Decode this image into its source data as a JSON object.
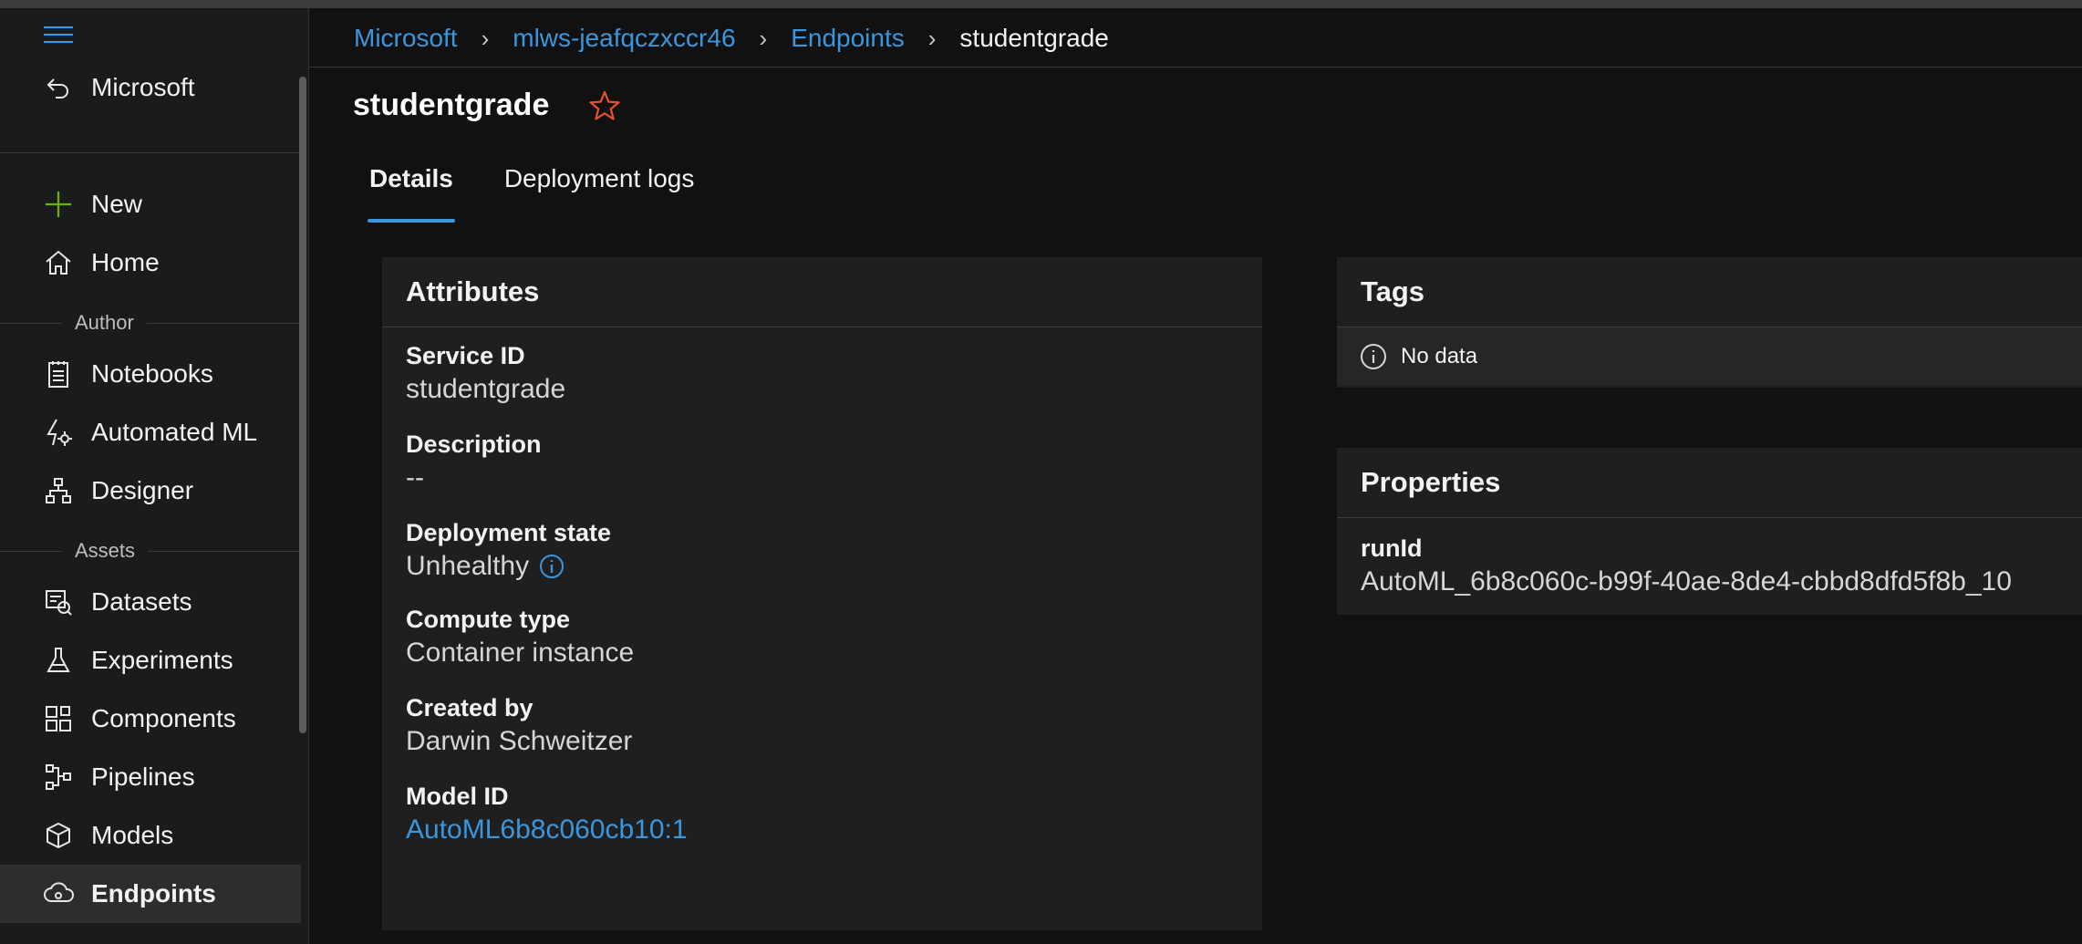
{
  "sidebar": {
    "back_label": "Microsoft",
    "items": [
      {
        "label": "New"
      },
      {
        "label": "Home"
      },
      {
        "label": "Notebooks"
      },
      {
        "label": "Automated ML"
      },
      {
        "label": "Designer"
      },
      {
        "label": "Datasets"
      },
      {
        "label": "Experiments"
      },
      {
        "label": "Components"
      },
      {
        "label": "Pipelines"
      },
      {
        "label": "Models"
      },
      {
        "label": "Endpoints"
      }
    ],
    "sections": {
      "author": "Author",
      "assets": "Assets"
    }
  },
  "breadcrumb": [
    "Microsoft",
    "mlws-jeafqczxccr46",
    "Endpoints",
    "studentgrade"
  ],
  "page": {
    "title": "studentgrade",
    "tabs": [
      "Details",
      "Deployment logs"
    ]
  },
  "attributes": {
    "title": "Attributes",
    "fields": [
      {
        "label": "Service ID",
        "value": "studentgrade"
      },
      {
        "label": "Description",
        "value": "--"
      },
      {
        "label": "Deployment state",
        "value": "Unhealthy"
      },
      {
        "label": "Compute type",
        "value": "Container instance"
      },
      {
        "label": "Created by",
        "value": "Darwin Schweitzer"
      },
      {
        "label": "Model ID",
        "value": "AutoML6b8c060cb10:1"
      }
    ]
  },
  "tags": {
    "title": "Tags",
    "empty_text": "No data"
  },
  "properties": {
    "title": "Properties",
    "fields": [
      {
        "label": "runId",
        "value": "AutoML_6b8c060c-b99f-40ae-8de4-cbbd8dfd5f8b_10"
      }
    ]
  },
  "colors": {
    "accent": "#3a96dd",
    "star": "#e8512c",
    "new_plus": "#6bb700"
  }
}
